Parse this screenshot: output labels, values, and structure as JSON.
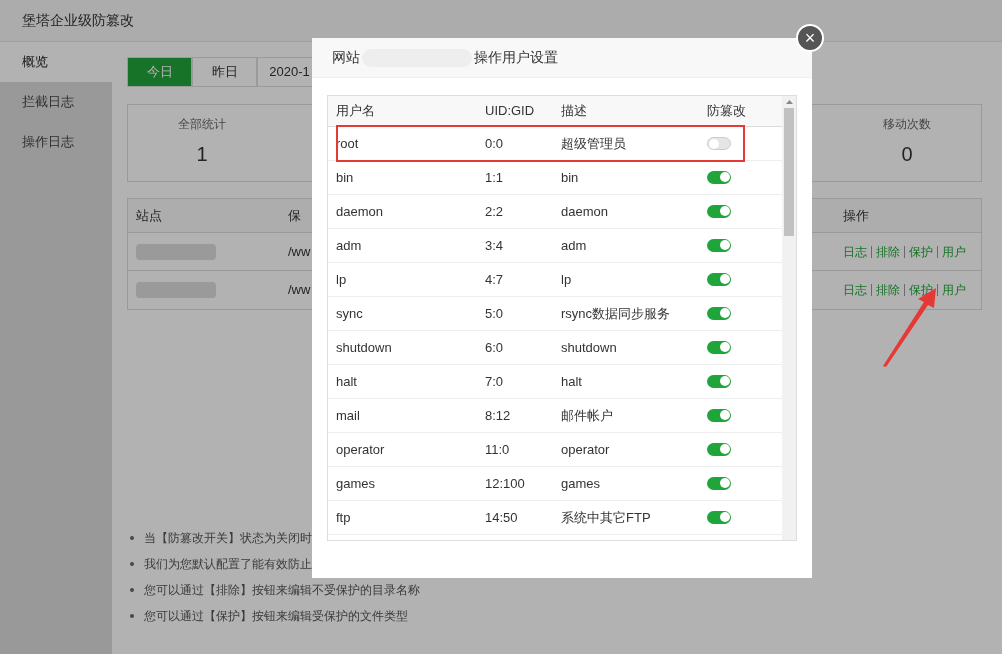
{
  "window": {
    "title": "堡塔企业级防篡改"
  },
  "sidebar": {
    "items": [
      {
        "label": "概览",
        "selected": true
      },
      {
        "label": "拦截日志",
        "selected": false
      },
      {
        "label": "操作日志",
        "selected": false
      }
    ]
  },
  "date_tabs": [
    {
      "label": "今日",
      "selected": true
    },
    {
      "label": "昨日",
      "selected": false
    },
    {
      "label": "2020-1",
      "selected": false
    }
  ],
  "stats": [
    {
      "label": "全部统计",
      "value": "1"
    },
    {
      "label": "移动次数",
      "value": "0"
    }
  ],
  "sites_table": {
    "columns": [
      "站点",
      "保"
    ],
    "action_column": "操作",
    "rows": [
      {
        "path": "/ww",
        "actions": [
          "日志",
          "排除",
          "保护",
          "用户"
        ]
      },
      {
        "path": "/ww",
        "actions": [
          "日志",
          "排除",
          "保护",
          "用户"
        ]
      }
    ]
  },
  "notes": [
    "当【防篡改开关】状态为关闭时",
    "我们为您默认配置了能有效防止",
    "您可以通过【排除】按钮来编辑不受保护的目录名称",
    "您可以通过【保护】按钮来编辑受保护的文件类型"
  ],
  "dialog": {
    "title_prefix": "网站",
    "title_suffix": "操作用户设置",
    "close": "×",
    "columns": [
      "用户名",
      "UID:GID",
      "描述",
      "防篡改"
    ],
    "rows": [
      {
        "name": "root",
        "ids": "0:0",
        "desc": "超级管理员",
        "on": false
      },
      {
        "name": "bin",
        "ids": "1:1",
        "desc": "bin",
        "on": true
      },
      {
        "name": "daemon",
        "ids": "2:2",
        "desc": "daemon",
        "on": true
      },
      {
        "name": "adm",
        "ids": "3:4",
        "desc": "adm",
        "on": true
      },
      {
        "name": "lp",
        "ids": "4:7",
        "desc": "lp",
        "on": true
      },
      {
        "name": "sync",
        "ids": "5:0",
        "desc": "rsync数据同步服务",
        "on": true
      },
      {
        "name": "shutdown",
        "ids": "6:0",
        "desc": "shutdown",
        "on": true
      },
      {
        "name": "halt",
        "ids": "7:0",
        "desc": "halt",
        "on": true
      },
      {
        "name": "mail",
        "ids": "8:12",
        "desc": "邮件帐户",
        "on": true
      },
      {
        "name": "operator",
        "ids": "11:0",
        "desc": "operator",
        "on": true
      },
      {
        "name": "games",
        "ids": "12:100",
        "desc": "games",
        "on": true
      },
      {
        "name": "ftp",
        "ids": "14:50",
        "desc": "系统中其它FTP",
        "on": true
      }
    ]
  }
}
